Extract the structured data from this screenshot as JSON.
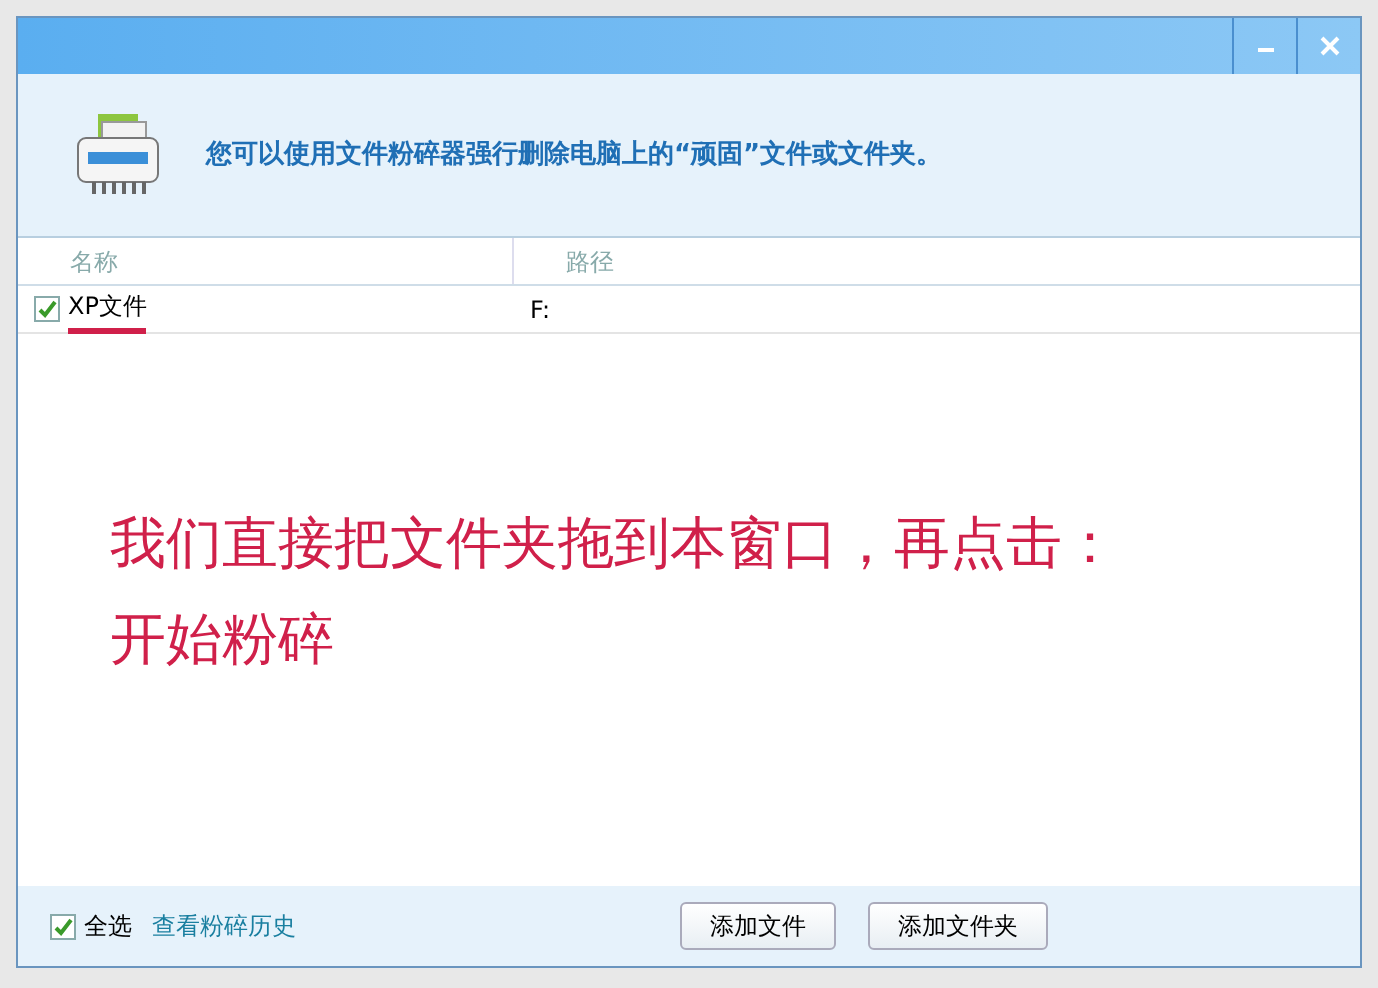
{
  "window": {
    "controls": [
      {
        "kind": "minimize"
      },
      {
        "kind": "close"
      }
    ]
  },
  "header": {
    "message": "您可以使用文件粉碎器强行删除电脑上的“顽固”文件或文件夹。"
  },
  "table": {
    "columns": [
      "名称",
      "路径"
    ],
    "rows": [
      {
        "name": "XP文件",
        "path": "F:",
        "checked": true
      }
    ]
  },
  "annotation": {
    "lines": [
      "我们直接把文件夹拖到本窗口，再点击：",
      "开始粉碎"
    ]
  },
  "footer": {
    "select_all": {
      "label": "全选",
      "checked": true
    },
    "history_link": "查看粉碎历史",
    "buttons": [
      "添加文件",
      "添加文件夹"
    ]
  }
}
